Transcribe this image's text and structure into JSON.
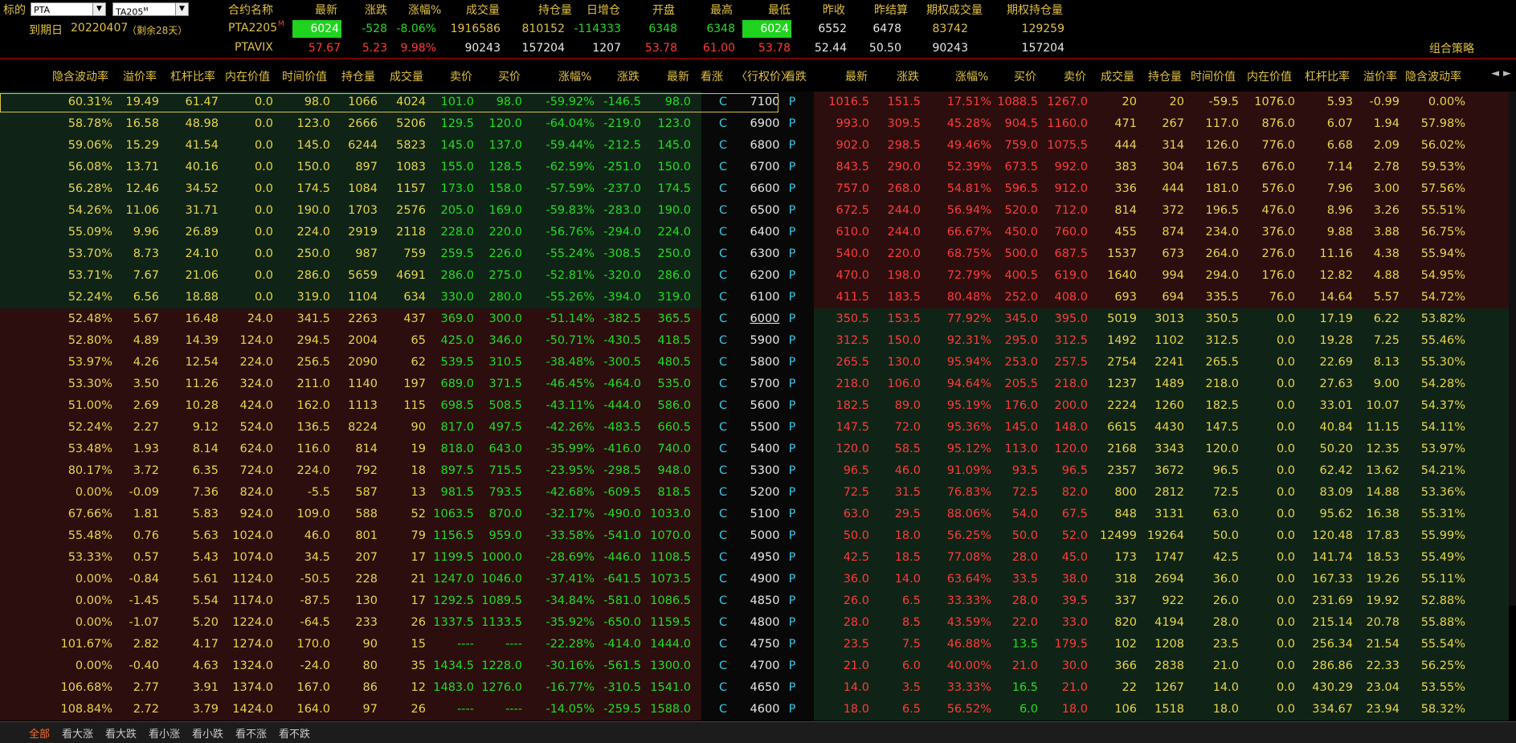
{
  "header": {
    "label_underlying": "标的",
    "underlying_select": "PTA",
    "contract_select": "TA205",
    "contract_select_sup": "M",
    "label_expiry": "到期日",
    "expiry_date": "20220407",
    "days_left": "（剩余28天）",
    "combo_strategy": "组合策略",
    "columns": [
      "合约名称",
      "最新",
      "涨跌",
      "涨幅%",
      "成交量",
      "持仓量",
      "日增仓",
      "开盘",
      "最高",
      "最低",
      "昨收",
      "昨结算",
      "期权成交量",
      "期权持仓量"
    ],
    "rows": [
      {
        "name": "PTA2205",
        "sup": "M",
        "last": "6024",
        "chg": "-528",
        "pct": "-8.06%",
        "vol": "1916586",
        "oi": "810152",
        "inc": "-114333",
        "open": "6348",
        "high": "6348",
        "low": "6024",
        "prev_close": "6552",
        "prev_settle": "6478",
        "opt_vol": "83742",
        "opt_oi": "129259"
      },
      {
        "name": "PTAVIX",
        "sup": "",
        "last": "57.67",
        "chg": "5.23",
        "pct": "9.98%",
        "vol": "90243",
        "oi": "157204",
        "inc": "1207",
        "open": "53.78",
        "high": "61.00",
        "low": "53.78",
        "prev_close": "52.44",
        "prev_settle": "50.50",
        "opt_vol": "90243",
        "opt_oi": "157204"
      }
    ]
  },
  "table": {
    "call_headers": [
      "隐含波动率",
      "溢价率",
      "杠杆比率",
      "内在价值",
      "时间价值",
      "持仓量",
      "成交量",
      "卖价",
      "买价",
      "涨幅%",
      "涨跌",
      "最新"
    ],
    "mid_headers": [
      "看涨",
      "〈行权价〉",
      "看跌"
    ],
    "put_headers": [
      "最新",
      "涨跌",
      "涨幅%",
      "买价",
      "卖价",
      "成交量",
      "持仓量",
      "时间价值",
      "内在价值",
      "杠杆比率",
      "溢价率",
      "隐含波动率"
    ],
    "scroll_left": "◄",
    "scroll_right": "►",
    "colors": {
      "itm_call_bg": "#0f2416",
      "otm_call_bg": "#2c0e0e",
      "itm_put_bg": "#2c0e0e",
      "otm_put_bg": "#0f2416",
      "strike_bg": "#080808"
    },
    "itm_call_count": 10,
    "rows": [
      {
        "strike": "7100",
        "c": [
          "60.31%",
          "19.49",
          "61.47",
          "0.0",
          "98.0",
          "1066",
          "4024",
          "101.0",
          "98.0",
          "-59.92%",
          "-146.5",
          "98.0"
        ],
        "p": [
          "1016.5",
          "151.5",
          "17.51%",
          "1088.5",
          "1267.0",
          "20",
          "20",
          "-59.5",
          "1076.0",
          "5.93",
          "-0.99",
          "0.00%"
        ]
      },
      {
        "strike": "6900",
        "c": [
          "58.78%",
          "16.58",
          "48.98",
          "0.0",
          "123.0",
          "2666",
          "5206",
          "129.5",
          "120.0",
          "-64.04%",
          "-219.0",
          "123.0"
        ],
        "p": [
          "993.0",
          "309.5",
          "45.28%",
          "904.5",
          "1160.0",
          "471",
          "267",
          "117.0",
          "876.0",
          "6.07",
          "1.94",
          "57.98%"
        ]
      },
      {
        "strike": "6800",
        "c": [
          "59.06%",
          "15.29",
          "41.54",
          "0.0",
          "145.0",
          "6244",
          "5823",
          "145.0",
          "137.0",
          "-59.44%",
          "-212.5",
          "145.0"
        ],
        "p": [
          "902.0",
          "298.5",
          "49.46%",
          "759.0",
          "1075.5",
          "444",
          "314",
          "126.0",
          "776.0",
          "6.68",
          "2.09",
          "56.02%"
        ]
      },
      {
        "strike": "6700",
        "c": [
          "56.08%",
          "13.71",
          "40.16",
          "0.0",
          "150.0",
          "897",
          "1083",
          "155.0",
          "128.5",
          "-62.59%",
          "-251.0",
          "150.0"
        ],
        "p": [
          "843.5",
          "290.0",
          "52.39%",
          "673.5",
          "992.0",
          "383",
          "304",
          "167.5",
          "676.0",
          "7.14",
          "2.78",
          "59.53%"
        ]
      },
      {
        "strike": "6600",
        "c": [
          "56.28%",
          "12.46",
          "34.52",
          "0.0",
          "174.5",
          "1084",
          "1157",
          "173.0",
          "158.0",
          "-57.59%",
          "-237.0",
          "174.5"
        ],
        "p": [
          "757.0",
          "268.0",
          "54.81%",
          "596.5",
          "912.0",
          "336",
          "444",
          "181.0",
          "576.0",
          "7.96",
          "3.00",
          "57.56%"
        ]
      },
      {
        "strike": "6500",
        "c": [
          "54.26%",
          "11.06",
          "31.71",
          "0.0",
          "190.0",
          "1703",
          "2576",
          "205.0",
          "169.0",
          "-59.83%",
          "-283.0",
          "190.0"
        ],
        "p": [
          "672.5",
          "244.0",
          "56.94%",
          "520.0",
          "712.0",
          "814",
          "372",
          "196.5",
          "476.0",
          "8.96",
          "3.26",
          "55.51%"
        ]
      },
      {
        "strike": "6400",
        "c": [
          "55.09%",
          "9.96",
          "26.89",
          "0.0",
          "224.0",
          "2919",
          "2118",
          "228.0",
          "220.0",
          "-56.76%",
          "-294.0",
          "224.0"
        ],
        "p": [
          "610.0",
          "244.0",
          "66.67%",
          "450.0",
          "760.0",
          "455",
          "874",
          "234.0",
          "376.0",
          "9.88",
          "3.88",
          "56.75%"
        ]
      },
      {
        "strike": "6300",
        "c": [
          "53.70%",
          "8.73",
          "24.10",
          "0.0",
          "250.0",
          "987",
          "759",
          "259.5",
          "226.0",
          "-55.24%",
          "-308.5",
          "250.0"
        ],
        "p": [
          "540.0",
          "220.0",
          "68.75%",
          "500.0",
          "687.5",
          "1537",
          "673",
          "264.0",
          "276.0",
          "11.16",
          "4.38",
          "55.94%"
        ]
      },
      {
        "strike": "6200",
        "c": [
          "53.71%",
          "7.67",
          "21.06",
          "0.0",
          "286.0",
          "5659",
          "4691",
          "286.0",
          "275.0",
          "-52.81%",
          "-320.0",
          "286.0"
        ],
        "p": [
          "470.0",
          "198.0",
          "72.79%",
          "400.5",
          "619.0",
          "1640",
          "994",
          "294.0",
          "176.0",
          "12.82",
          "4.88",
          "54.95%"
        ]
      },
      {
        "strike": "6100",
        "c": [
          "52.24%",
          "6.56",
          "18.88",
          "0.0",
          "319.0",
          "1104",
          "634",
          "330.0",
          "280.0",
          "-55.26%",
          "-394.0",
          "319.0"
        ],
        "p": [
          "411.5",
          "183.5",
          "80.48%",
          "252.0",
          "408.0",
          "693",
          "694",
          "335.5",
          "76.0",
          "14.64",
          "5.57",
          "54.72%"
        ]
      },
      {
        "strike": "6000",
        "c": [
          "52.48%",
          "5.67",
          "16.48",
          "24.0",
          "341.5",
          "2263",
          "437",
          "369.0",
          "300.0",
          "-51.14%",
          "-382.5",
          "365.5"
        ],
        "p": [
          "350.5",
          "153.5",
          "77.92%",
          "345.0",
          "395.0",
          "5019",
          "3013",
          "350.5",
          "0.0",
          "17.19",
          "6.22",
          "53.82%"
        ]
      },
      {
        "strike": "5900",
        "c": [
          "52.80%",
          "4.89",
          "14.39",
          "124.0",
          "294.5",
          "2004",
          "65",
          "425.0",
          "346.0",
          "-50.71%",
          "-430.5",
          "418.5"
        ],
        "p": [
          "312.5",
          "150.0",
          "92.31%",
          "295.0",
          "312.5",
          "1492",
          "1102",
          "312.5",
          "0.0",
          "19.28",
          "7.25",
          "55.46%"
        ]
      },
      {
        "strike": "5800",
        "c": [
          "53.97%",
          "4.26",
          "12.54",
          "224.0",
          "256.5",
          "2090",
          "62",
          "539.5",
          "310.5",
          "-38.48%",
          "-300.5",
          "480.5"
        ],
        "p": [
          "265.5",
          "130.0",
          "95.94%",
          "253.0",
          "257.5",
          "2754",
          "2241",
          "265.5",
          "0.0",
          "22.69",
          "8.13",
          "55.30%"
        ]
      },
      {
        "strike": "5700",
        "c": [
          "53.30%",
          "3.50",
          "11.26",
          "324.0",
          "211.0",
          "1140",
          "197",
          "689.0",
          "371.5",
          "-46.45%",
          "-464.0",
          "535.0"
        ],
        "p": [
          "218.0",
          "106.0",
          "94.64%",
          "205.5",
          "218.0",
          "1237",
          "1489",
          "218.0",
          "0.0",
          "27.63",
          "9.00",
          "54.28%"
        ]
      },
      {
        "strike": "5600",
        "c": [
          "51.00%",
          "2.69",
          "10.28",
          "424.0",
          "162.0",
          "1113",
          "115",
          "698.5",
          "508.5",
          "-43.11%",
          "-444.0",
          "586.0"
        ],
        "p": [
          "182.5",
          "89.0",
          "95.19%",
          "176.0",
          "200.0",
          "2224",
          "1260",
          "182.5",
          "0.0",
          "33.01",
          "10.07",
          "54.37%"
        ]
      },
      {
        "strike": "5500",
        "c": [
          "52.24%",
          "2.27",
          "9.12",
          "524.0",
          "136.5",
          "8224",
          "90",
          "817.0",
          "497.5",
          "-42.26%",
          "-483.5",
          "660.5"
        ],
        "p": [
          "147.5",
          "72.0",
          "95.36%",
          "145.0",
          "148.0",
          "6615",
          "4430",
          "147.5",
          "0.0",
          "40.84",
          "11.15",
          "54.11%"
        ]
      },
      {
        "strike": "5400",
        "c": [
          "53.48%",
          "1.93",
          "8.14",
          "624.0",
          "116.0",
          "814",
          "19",
          "818.0",
          "643.0",
          "-35.99%",
          "-416.0",
          "740.0"
        ],
        "p": [
          "120.0",
          "58.5",
          "95.12%",
          "113.0",
          "120.0",
          "2168",
          "3343",
          "120.0",
          "0.0",
          "50.20",
          "12.35",
          "53.97%"
        ]
      },
      {
        "strike": "5300",
        "c": [
          "80.17%",
          "3.72",
          "6.35",
          "724.0",
          "224.0",
          "792",
          "18",
          "897.5",
          "715.5",
          "-23.95%",
          "-298.5",
          "948.0"
        ],
        "p": [
          "96.5",
          "46.0",
          "91.09%",
          "93.5",
          "96.5",
          "2357",
          "3672",
          "96.5",
          "0.0",
          "62.42",
          "13.62",
          "54.21%"
        ]
      },
      {
        "strike": "5200",
        "c": [
          "0.00%",
          "-0.09",
          "7.36",
          "824.0",
          "-5.5",
          "587",
          "13",
          "981.5",
          "793.5",
          "-42.68%",
          "-609.5",
          "818.5"
        ],
        "p": [
          "72.5",
          "31.5",
          "76.83%",
          "72.5",
          "82.0",
          "800",
          "2812",
          "72.5",
          "0.0",
          "83.09",
          "14.88",
          "53.36%"
        ]
      },
      {
        "strike": "5100",
        "c": [
          "67.66%",
          "1.81",
          "5.83",
          "924.0",
          "109.0",
          "588",
          "52",
          "1063.5",
          "870.0",
          "-32.17%",
          "-490.0",
          "1033.0"
        ],
        "p": [
          "63.0",
          "29.5",
          "88.06%",
          "54.0",
          "67.5",
          "848",
          "3131",
          "63.0",
          "0.0",
          "95.62",
          "16.38",
          "55.31%"
        ]
      },
      {
        "strike": "5000",
        "c": [
          "55.48%",
          "0.76",
          "5.63",
          "1024.0",
          "46.0",
          "801",
          "79",
          "1156.5",
          "959.0",
          "-33.58%",
          "-541.0",
          "1070.0"
        ],
        "p": [
          "50.0",
          "18.0",
          "56.25%",
          "50.0",
          "52.0",
          "12499",
          "19264",
          "50.0",
          "0.0",
          "120.48",
          "17.83",
          "55.99%"
        ]
      },
      {
        "strike": "4950",
        "c": [
          "53.33%",
          "0.57",
          "5.43",
          "1074.0",
          "34.5",
          "207",
          "17",
          "1199.5",
          "1000.0",
          "-28.69%",
          "-446.0",
          "1108.5"
        ],
        "p": [
          "42.5",
          "18.5",
          "77.08%",
          "28.0",
          "45.0",
          "173",
          "1747",
          "42.5",
          "0.0",
          "141.74",
          "18.53",
          "55.49%"
        ]
      },
      {
        "strike": "4900",
        "c": [
          "0.00%",
          "-0.84",
          "5.61",
          "1124.0",
          "-50.5",
          "228",
          "21",
          "1247.0",
          "1046.0",
          "-37.41%",
          "-641.5",
          "1073.5"
        ],
        "p": [
          "36.0",
          "14.0",
          "63.64%",
          "33.5",
          "38.0",
          "318",
          "2694",
          "36.0",
          "0.0",
          "167.33",
          "19.26",
          "55.11%"
        ]
      },
      {
        "strike": "4850",
        "c": [
          "0.00%",
          "-1.45",
          "5.54",
          "1174.0",
          "-87.5",
          "130",
          "17",
          "1292.5",
          "1089.5",
          "-34.84%",
          "-581.0",
          "1086.5"
        ],
        "p": [
          "26.0",
          "6.5",
          "33.33%",
          "28.0",
          "39.5",
          "337",
          "922",
          "26.0",
          "0.0",
          "231.69",
          "19.92",
          "52.88%"
        ]
      },
      {
        "strike": "4800",
        "c": [
          "0.00%",
          "-1.07",
          "5.20",
          "1224.0",
          "-64.5",
          "233",
          "26",
          "1337.5",
          "1133.5",
          "-35.92%",
          "-650.0",
          "1159.5"
        ],
        "p": [
          "28.0",
          "8.5",
          "43.59%",
          "22.0",
          "33.0",
          "820",
          "4194",
          "28.0",
          "0.0",
          "215.14",
          "20.78",
          "55.88%"
        ]
      },
      {
        "strike": "4750",
        "c": [
          "101.67%",
          "2.82",
          "4.17",
          "1274.0",
          "170.0",
          "90",
          "15",
          "----",
          "----",
          "-22.28%",
          "-414.0",
          "1444.0"
        ],
        "p": [
          "23.5",
          "7.5",
          "46.88%",
          "13.5",
          "179.5",
          "102",
          "1208",
          "23.5",
          "0.0",
          "256.34",
          "21.54",
          "55.54%"
        ]
      },
      {
        "strike": "4700",
        "c": [
          "0.00%",
          "-0.40",
          "4.63",
          "1324.0",
          "-24.0",
          "80",
          "35",
          "1434.5",
          "1228.0",
          "-30.16%",
          "-561.5",
          "1300.0"
        ],
        "p": [
          "21.0",
          "6.0",
          "40.00%",
          "21.0",
          "30.0",
          "366",
          "2838",
          "21.0",
          "0.0",
          "286.86",
          "22.33",
          "56.25%"
        ]
      },
      {
        "strike": "4650",
        "c": [
          "106.68%",
          "2.77",
          "3.91",
          "1374.0",
          "167.0",
          "86",
          "12",
          "1483.0",
          "1276.0",
          "-16.77%",
          "-310.5",
          "1541.0"
        ],
        "p": [
          "14.0",
          "3.5",
          "33.33%",
          "16.5",
          "21.0",
          "22",
          "1267",
          "14.0",
          "0.0",
          "430.29",
          "23.04",
          "53.55%"
        ]
      },
      {
        "strike": "4600",
        "c": [
          "108.84%",
          "2.72",
          "3.79",
          "1424.0",
          "164.0",
          "97",
          "26",
          "----",
          "----",
          "-14.05%",
          "-259.5",
          "1588.0"
        ],
        "p": [
          "18.0",
          "6.5",
          "56.52%",
          "6.0",
          "18.0",
          "106",
          "1518",
          "18.0",
          "0.0",
          "334.67",
          "23.94",
          "58.32%"
        ]
      }
    ]
  },
  "footer": {
    "tabs": [
      "全部",
      "看大涨",
      "看大跌",
      "看小涨",
      "看小跌",
      "看不涨",
      "看不跌"
    ],
    "active": 0
  }
}
